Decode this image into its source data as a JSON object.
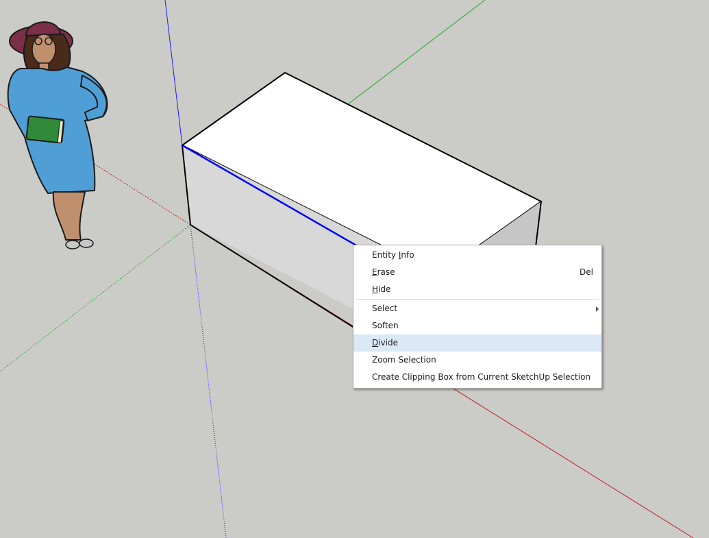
{
  "viewport": {
    "background": "#cbcbc7",
    "axis_colors": {
      "red": "#c21a1a",
      "green": "#1faa1f",
      "blue": "#1a1aff"
    }
  },
  "scene": {
    "box": {
      "top_face": "#ffffff",
      "front_face": "#d8d8d8",
      "side_face": "#c6c6c6",
      "edge_color": "#000000",
      "selected_edge_color": "#0000ff"
    },
    "figure": {
      "dress_color": "#4f9fd6",
      "hat_color": "#7b2e48",
      "book_color": "#2f8a3a",
      "skin_color": "#bf8f6e"
    }
  },
  "context_menu": {
    "items": [
      {
        "label": "Entity Info",
        "underline_char": "I"
      },
      {
        "label": "Erase",
        "underline_char": "E",
        "shortcut": "Del"
      },
      {
        "label": "Hide",
        "underline_char": "H"
      },
      {
        "label": "Select",
        "has_submenu": true
      },
      {
        "label": "Soften"
      },
      {
        "label": "Divide",
        "underline_char": "D",
        "highlighted": true
      },
      {
        "label": "Zoom Selection"
      },
      {
        "label": "Create Clipping Box from Current SketchUp Selection"
      }
    ],
    "highlight_color": "#dbe9f6"
  }
}
